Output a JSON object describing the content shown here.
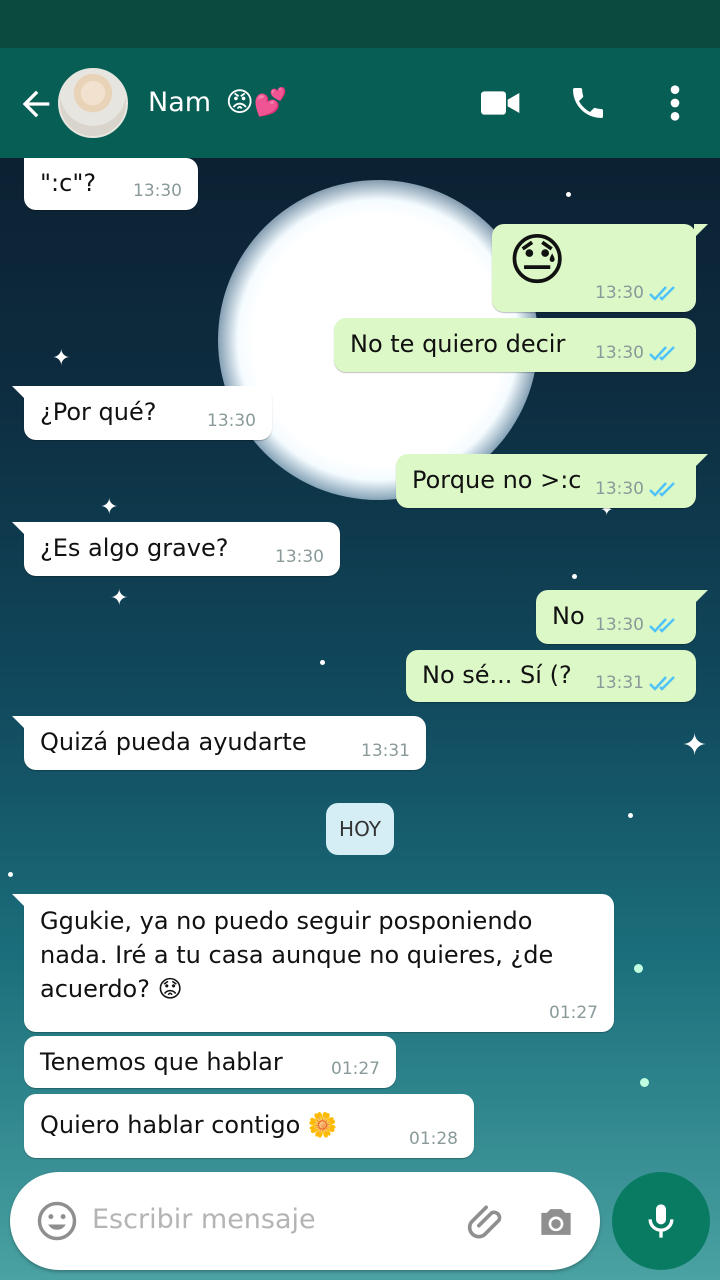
{
  "header": {
    "contact_name": "Nam",
    "contact_emojis": "😡💕",
    "icons": [
      "back-arrow-icon",
      "video-call-icon",
      "phone-icon",
      "more-vert-icon"
    ]
  },
  "messages": [
    {
      "dir": "in",
      "text": "\":c\"?",
      "time": "13:30"
    },
    {
      "dir": "out",
      "text": "😓",
      "time": "13:30",
      "status": "read"
    },
    {
      "dir": "out",
      "text": "No te quiero decir",
      "time": "13:30",
      "status": "read"
    },
    {
      "dir": "in",
      "text": "¿Por qué?",
      "time": "13:30"
    },
    {
      "dir": "out",
      "text": "Porque no >:c",
      "time": "13:30",
      "status": "read"
    },
    {
      "dir": "in",
      "text": "¿Es algo grave?",
      "time": "13:30"
    },
    {
      "dir": "out",
      "text": "No",
      "time": "13:30",
      "status": "read"
    },
    {
      "dir": "out",
      "text": "No sé... Sí (?",
      "time": "13:31",
      "status": "read"
    },
    {
      "dir": "in",
      "text": "Quizá pueda ayudarte",
      "time": "13:31"
    },
    {
      "dir": "in",
      "text": "Ggukie, ya no puedo seguir posponiendo nada. Iré a tu casa aunque no quieres, ¿de acuerdo? 😟",
      "time": "01:27"
    },
    {
      "dir": "in",
      "text": "Tenemos que hablar",
      "time": "01:27"
    },
    {
      "dir": "in",
      "text": "Quiero hablar contigo 🌼",
      "time": "01:28"
    }
  ],
  "day_separator": "HOY",
  "composer": {
    "placeholder": "Escribir mensaje"
  },
  "colors": {
    "appbar": "#075e54",
    "outgoing": "#dcf8c6",
    "incoming": "#ffffff",
    "read_ticks": "#4fc3f7",
    "mic": "#0a7b63"
  }
}
